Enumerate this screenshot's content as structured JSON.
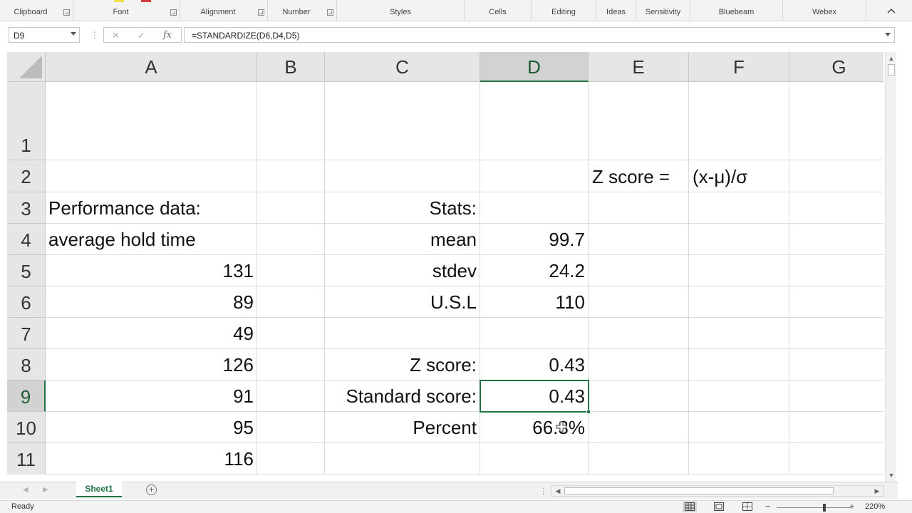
{
  "ribbon": {
    "groups": [
      {
        "label": "Clipboard"
      },
      {
        "label": "Font"
      },
      {
        "label": "Alignment"
      },
      {
        "label": "Number"
      },
      {
        "label": "Styles"
      },
      {
        "label": "Cells"
      },
      {
        "label": "Editing"
      },
      {
        "label": "Ideas"
      },
      {
        "label": "Sensitivity"
      },
      {
        "label": "Bluebeam"
      },
      {
        "label": "Webex"
      }
    ]
  },
  "formula_bar": {
    "name_box": "D9",
    "formula": "=STANDARDIZE(D6,D4,D5)",
    "cancel_icon": "✕",
    "enter_icon": "✓",
    "fx_label": "fx"
  },
  "grid": {
    "columns": [
      "A",
      "B",
      "C",
      "D",
      "E",
      "F",
      "G"
    ],
    "selected_column": "D",
    "selected_row": "9",
    "rows": [
      "1",
      "2",
      "3",
      "4",
      "5",
      "6",
      "7",
      "8",
      "9",
      "10",
      "11"
    ],
    "cells": {
      "E2": "Z score =",
      "F2": "(x-μ)/σ",
      "A3": "Performance data:",
      "C3": "Stats:",
      "A4": "average hold time",
      "C4": "mean",
      "D4": "99.7",
      "A5": "131",
      "C5": "stdev",
      "D5": "24.2",
      "A6": "89",
      "C6": "U.S.L",
      "D6": "110",
      "A7": "49",
      "A8": "126",
      "C8": "Z score:",
      "D8": "0.43",
      "A9": "91",
      "C9": "Standard score:",
      "D9": "0.43",
      "A10": "95",
      "C10": "Percent",
      "D10": "66.3%",
      "A11": "116"
    }
  },
  "sheet_tabs": {
    "tabs": [
      "Sheet1"
    ],
    "active": "Sheet1",
    "add_label": "+"
  },
  "status_bar": {
    "status": "Ready",
    "zoom_level": "220%",
    "zoom_minus": "−",
    "zoom_plus": "+"
  },
  "colors": {
    "accent": "#217346"
  }
}
